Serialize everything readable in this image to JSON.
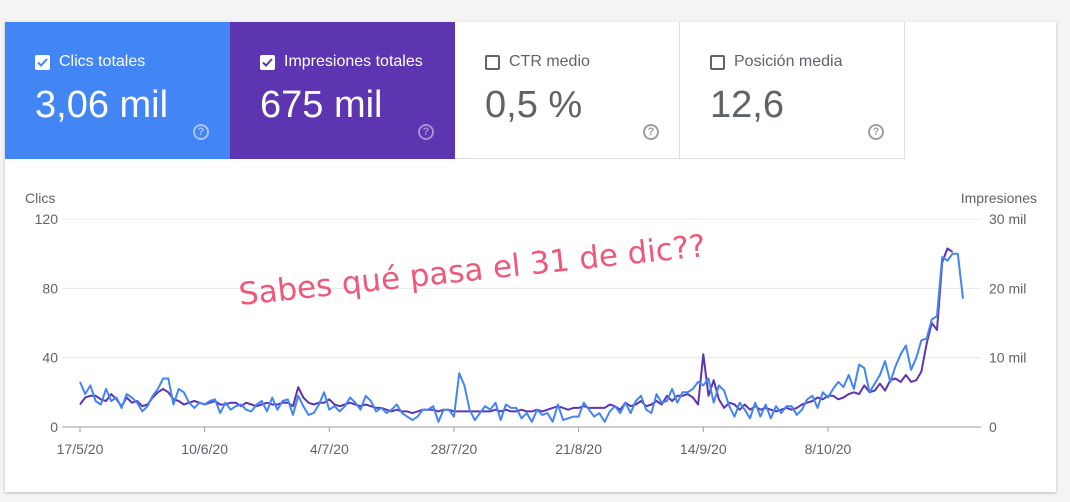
{
  "metrics": [
    {
      "label": "Clics totales",
      "value": "3,06 mil",
      "checked": true,
      "color": "#4285f4"
    },
    {
      "label": "Impresiones totales",
      "value": "675 mil",
      "checked": true,
      "color": "#5e35b1"
    },
    {
      "label": "CTR medio",
      "value": "0,5 %",
      "checked": false,
      "color": "#00897b"
    },
    {
      "label": "Posición media",
      "value": "12,6",
      "checked": false,
      "color": "#e8710a"
    }
  ],
  "annotation": "Sabes qué pasa el 31 de dic??",
  "chart_data": {
    "type": "line",
    "xlabel": "",
    "x_ticks": [
      "17/5/20",
      "10/6/20",
      "4/7/20",
      "28/7/20",
      "21/8/20",
      "14/9/20",
      "8/10/20"
    ],
    "y_left": {
      "label": "Clics",
      "ticks": [
        "0",
        "40",
        "80",
        "120"
      ],
      "ylim": [
        0,
        120
      ]
    },
    "y_right": {
      "label": "Impresiones",
      "ticks": [
        "0",
        "10 mil",
        "20 mil",
        "30 mil"
      ],
      "ylim": [
        0,
        30000
      ]
    },
    "grid": true,
    "x_start": "2020-05-17",
    "series": [
      {
        "name": "Clics totales",
        "axis": "left",
        "color": "#4285f4",
        "values": [
          26,
          19,
          24,
          15,
          13,
          22,
          15,
          17,
          11,
          19,
          17,
          14,
          9,
          12,
          18,
          22,
          28,
          28,
          13,
          22,
          20,
          14,
          11,
          14,
          13,
          15,
          16,
          8,
          14,
          10,
          12,
          13,
          10,
          9,
          13,
          15,
          9,
          17,
          10,
          15,
          16,
          7,
          18,
          12,
          7,
          8,
          13,
          20,
          10,
          12,
          9,
          12,
          17,
          14,
          10,
          18,
          15,
          9,
          11,
          8,
          10,
          13,
          8,
          6,
          4,
          6,
          10,
          10,
          12,
          3,
          10,
          10,
          6,
          31,
          24,
          10,
          4,
          8,
          12,
          10,
          14,
          4,
          13,
          11,
          11,
          5,
          8,
          3,
          10,
          7,
          8,
          3,
          13,
          4,
          5,
          6,
          6,
          14,
          10,
          6,
          8,
          3,
          9,
          12,
          8,
          14,
          8,
          15,
          18,
          10,
          8,
          19,
          14,
          15,
          22,
          14,
          20,
          20,
          22,
          26,
          24,
          28,
          14,
          24,
          21,
          12,
          6,
          14,
          10,
          5,
          14,
          6,
          13,
          5,
          12,
          8,
          12,
          12,
          7,
          10,
          16,
          18,
          11,
          20,
          17,
          22,
          26,
          23,
          30,
          22,
          36,
          34,
          20,
          25,
          30,
          38,
          26,
          35,
          42,
          47,
          33,
          40,
          50,
          51,
          62,
          64,
          98,
          96,
          100,
          100,
          74
        ]
      },
      {
        "name": "Impresiones totales",
        "axis": "right",
        "color": "#5e35b1",
        "values": [
          3250,
          4250,
          4500,
          4500,
          4000,
          3750,
          4750,
          4000,
          3000,
          4250,
          3500,
          3750,
          3000,
          3250,
          4250,
          5000,
          5500,
          5000,
          4000,
          3750,
          3250,
          3500,
          3750,
          3500,
          3250,
          3500,
          3750,
          3250,
          3250,
          3500,
          3500,
          3000,
          3500,
          3250,
          3000,
          3250,
          3500,
          3250,
          3250,
          3500,
          3500,
          3000,
          5750,
          4250,
          3500,
          3250,
          3500,
          3500,
          4000,
          3250,
          3000,
          3250,
          3500,
          3250,
          3000,
          3250,
          3000,
          2750,
          2750,
          2500,
          2250,
          2500,
          2250,
          2250,
          2000,
          2250,
          2500,
          2500,
          2500,
          2250,
          2500,
          2500,
          2250,
          2250,
          2250,
          2250,
          2250,
          2250,
          2250,
          2250,
          2500,
          2250,
          2500,
          2250,
          2250,
          2500,
          2250,
          2250,
          2500,
          2250,
          2500,
          2750,
          3000,
          2750,
          2500,
          2750,
          2750,
          3000,
          2750,
          2750,
          2750,
          2750,
          3250,
          3000,
          2500,
          3500,
          3000,
          3250,
          3750,
          3000,
          3250,
          3750,
          3250,
          4500,
          3750,
          4500,
          4500,
          4750,
          4250,
          3250,
          10500,
          4500,
          6750,
          4000,
          2750,
          3500,
          3250,
          2500,
          3250,
          2500,
          3000,
          2500,
          2750,
          2500,
          2250,
          2500,
          2750,
          2500,
          2750,
          3250,
          3500,
          3750,
          4250,
          4000,
          4500,
          4500,
          4000,
          4250,
          4750,
          5000,
          4750,
          6000,
          5000,
          5250,
          6250,
          5250,
          6750,
          7000,
          6500,
          7500,
          6500,
          6750,
          8000,
          12000,
          15000,
          14000,
          23750,
          25750,
          25250
        ]
      }
    ]
  }
}
